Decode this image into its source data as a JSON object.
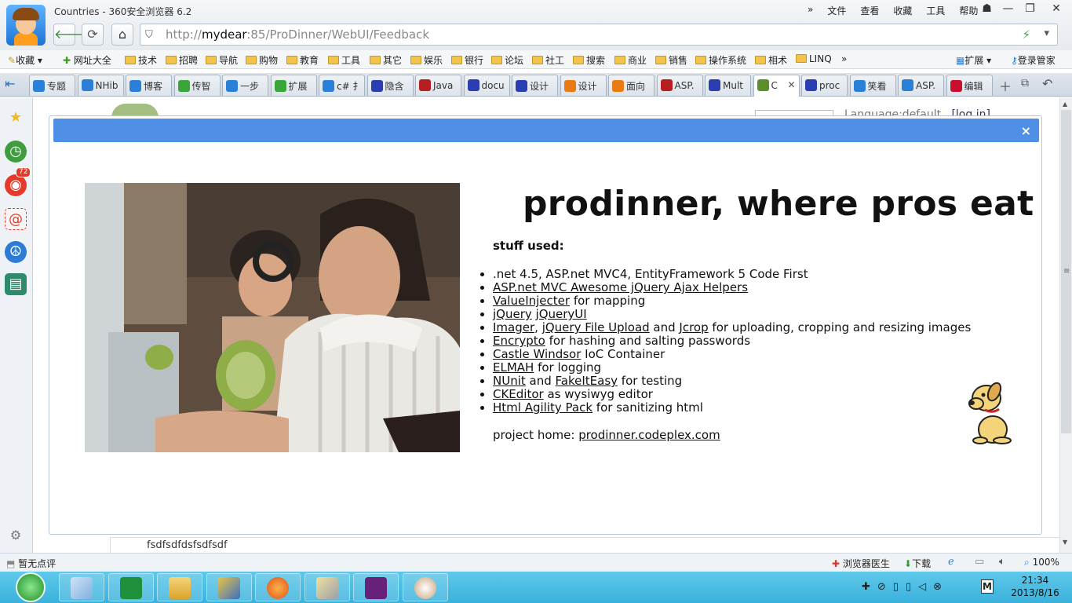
{
  "window": {
    "title": "Countries - 360安全浏览器 6.2",
    "menus": [
      "»",
      "文件",
      "查看",
      "收藏",
      "工具",
      "帮助"
    ]
  },
  "address": {
    "prefix": "http://",
    "host": "mydear",
    "rest": ":85/ProDinner/WebUI/Feedback"
  },
  "favorites": {
    "items": [
      "收藏",
      "网址大全",
      "技术",
      "招聘",
      "导航",
      "购物",
      "教育",
      "工具",
      "其它",
      "娱乐",
      "银行",
      "论坛",
      "社工",
      "搜索",
      "商业",
      "销售",
      "操作系统",
      "相术",
      "LINQ",
      "»"
    ],
    "extend": "扩展",
    "manager": "登录管家"
  },
  "tabs": [
    {
      "label": "专题",
      "icon": "ie-icon",
      "color": "#2b7fd6"
    },
    {
      "label": "NHib",
      "icon": "ie-icon",
      "color": "#2b7fd6"
    },
    {
      "label": "博客",
      "icon": "ie-icon",
      "color": "#2b7fd6"
    },
    {
      "label": "传智",
      "icon": "search-icon",
      "color": "#3aa63a"
    },
    {
      "label": "一步",
      "icon": "ie-icon",
      "color": "#2b7fd6"
    },
    {
      "label": "扩展",
      "icon": "search-icon",
      "color": "#3aa63a"
    },
    {
      "label": "c# 扌",
      "icon": "ie-icon",
      "color": "#2b7fd6"
    },
    {
      "label": "隐含",
      "icon": "baidu-icon",
      "color": "#2a3eb1"
    },
    {
      "label": "Java",
      "icon": "w3-icon",
      "color": "#b51f1f"
    },
    {
      "label": "docu",
      "icon": "baidu-icon",
      "color": "#2a3eb1"
    },
    {
      "label": "设计",
      "icon": "baidu-icon",
      "color": "#2a3eb1"
    },
    {
      "label": "设计",
      "icon": "j-icon",
      "color": "#e87b11"
    },
    {
      "label": "面向",
      "icon": "j-icon",
      "color": "#e87b11"
    },
    {
      "label": "ASP.",
      "icon": "w3-icon",
      "color": "#b51f1f"
    },
    {
      "label": "Mult",
      "icon": "baidu-icon",
      "color": "#2a3eb1"
    },
    {
      "label": "C",
      "icon": "broccoli-icon",
      "color": "#5a8f2a",
      "active": true
    },
    {
      "label": "proc",
      "icon": "baidu-icon",
      "color": "#2a3eb1"
    },
    {
      "label": "笑看",
      "icon": "ie-icon",
      "color": "#2b7fd6"
    },
    {
      "label": "ASP.",
      "icon": "ie-icon",
      "color": "#2b7fd6"
    },
    {
      "label": "编辑",
      "icon": "c-icon",
      "color": "#c8102e"
    }
  ],
  "sidebar": {
    "weibo_badge": "72"
  },
  "behind": {
    "language": "Language:default",
    "login": "[log in]",
    "footer_text": "fsdfsdfdsfsdfsdf"
  },
  "modal": {
    "close": "×",
    "heading": "prodinner, where pros eat",
    "stuff_label": "stuff used:",
    "list": [
      [
        {
          "t": ".net 4.5, ASP.net MVC4, EntityFramework 5 Code First"
        }
      ],
      [
        {
          "t": "ASP.net MVC Awesome jQuery Ajax Helpers",
          "link": true
        }
      ],
      [
        {
          "t": "ValueInjecter",
          "link": true
        },
        {
          "t": " for mapping"
        }
      ],
      [
        {
          "t": "jQuery",
          "link": true
        },
        {
          "t": " "
        },
        {
          "t": "jQueryUI",
          "link": true
        }
      ],
      [
        {
          "t": "Imager",
          "link": true
        },
        {
          "t": ", "
        },
        {
          "t": "jQuery File Upload",
          "link": true
        },
        {
          "t": " and "
        },
        {
          "t": "Jcrop",
          "link": true
        },
        {
          "t": " for uploading, cropping and resizing images"
        }
      ],
      [
        {
          "t": "Encrypto",
          "link": true
        },
        {
          "t": " for hashing and salting passwords"
        }
      ],
      [
        {
          "t": "Castle Windsor",
          "link": true
        },
        {
          "t": " IoC Container"
        }
      ],
      [
        {
          "t": "ELMAH",
          "link": true
        },
        {
          "t": " for logging"
        }
      ],
      [
        {
          "t": "NUnit",
          "link": true
        },
        {
          "t": " and "
        },
        {
          "t": "FakeItEasy",
          "link": true
        },
        {
          "t": " for testing"
        }
      ],
      [
        {
          "t": "CKEditor",
          "link": true
        },
        {
          "t": " as wysiwyg editor"
        }
      ],
      [
        {
          "t": "Html Agility Pack",
          "link": true
        },
        {
          "t": " for sanitizing html"
        }
      ]
    ],
    "project_home_label": "project home: ",
    "project_home_link": "prodinner.codeplex.com"
  },
  "status": {
    "left": "暂无点评",
    "doctor": "浏览器医生",
    "download": "下载",
    "zoom": "100%"
  },
  "taskbar": {
    "time": "21:34",
    "date": "2013/8/16"
  }
}
